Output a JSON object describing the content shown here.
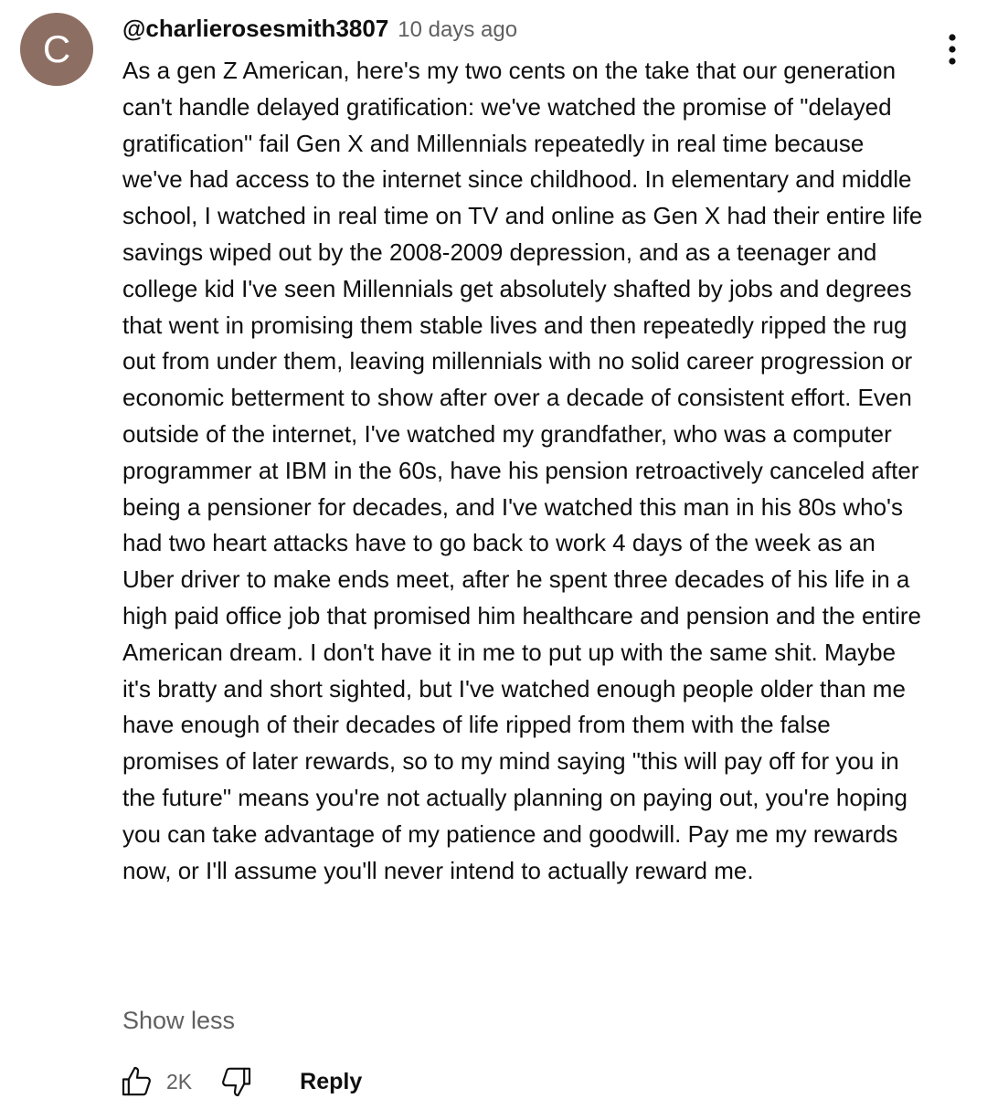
{
  "comment": {
    "avatar_letter": "C",
    "author": "@charlierosesmith3807",
    "timestamp": "10 days ago",
    "menu_icon": "more-vertical-icon",
    "text": "As a gen Z American, here's my two cents on the take that our generation can't handle delayed gratification: we've watched the promise of \"delayed gratification\" fail Gen X and Millennials repeatedly in real time because we've had access to the internet since childhood. In elementary and middle school, I watched in real time on TV and online as Gen X had their entire life savings wiped out by the 2008-2009 depression, and as a teenager and college kid I've seen Millennials get absolutely shafted by jobs and degrees that went in promising them stable lives and then repeatedly ripped the rug out from under them, leaving millennials with no solid career progression or economic betterment to show after over a decade of consistent effort. Even outside of the internet, I've watched my grandfather, who was a computer programmer at IBM in the 60s, have his pension retroactively canceled after being a pensioner for decades, and I've watched this man in his 80s who's had two heart attacks have to go back to work 4 days of the week as an Uber driver to make ends meet, after he spent three decades of his life in a high paid office job that promised him healthcare and pension and the entire American dream. I don't have it in me to put up with the same shit. Maybe it's bratty and short sighted, but I've watched enough people older than me have enough of their decades of life ripped from them with the false promises of later rewards, so to my mind saying \"this will pay off for you in the future\" means you're not actually planning on paying out, you're hoping you can take advantage of my patience and goodwill. Pay me my rewards now, or I'll assume you'll never intend to actually reward me.",
    "show_less_label": "Show less",
    "like_count": "2K",
    "reply_label": "Reply"
  },
  "icons": {
    "like": "thumbs-up-icon",
    "dislike": "thumbs-down-icon"
  },
  "colors": {
    "avatar_bg": "#8d6e63",
    "secondary_text": "#606060",
    "primary_text": "#0f0f0f"
  }
}
